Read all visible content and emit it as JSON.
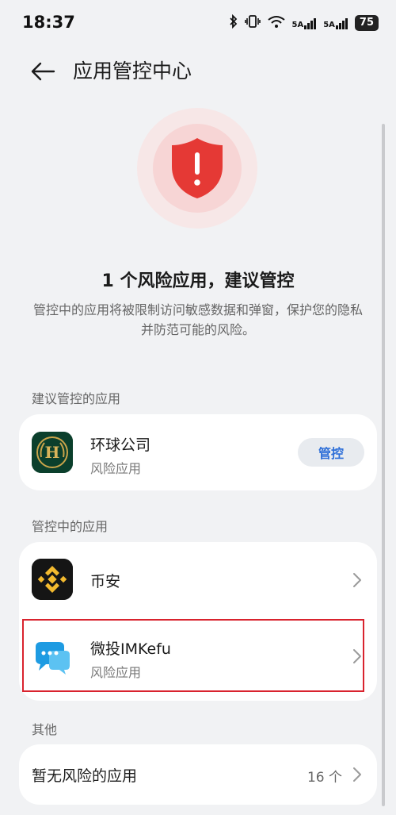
{
  "status_bar": {
    "time": "18:37",
    "signal1": "5A",
    "signal2": "5A",
    "battery": "75"
  },
  "header": {
    "title": "应用管控中心"
  },
  "summary": {
    "title": "1 个风险应用，建议管控",
    "description": "管控中的应用将被限制访问敏感数据和弹窗，保护您的隐私并防范可能的风险。"
  },
  "suggested": {
    "label": "建议管控的应用",
    "apps": [
      {
        "name": "环球公司",
        "subtitle": "风险应用",
        "action": "管控"
      }
    ]
  },
  "managed": {
    "label": "管控中的应用",
    "apps": [
      {
        "name": "币安"
      },
      {
        "name": "微投IMKefu",
        "subtitle": "风险应用"
      }
    ]
  },
  "other": {
    "label": "其他",
    "item": {
      "name": "暂无风险的应用",
      "count": "16 个"
    }
  },
  "colors": {
    "accent": "#2e6fd8",
    "danger": "#e53935",
    "highlight": "#d9232e"
  }
}
